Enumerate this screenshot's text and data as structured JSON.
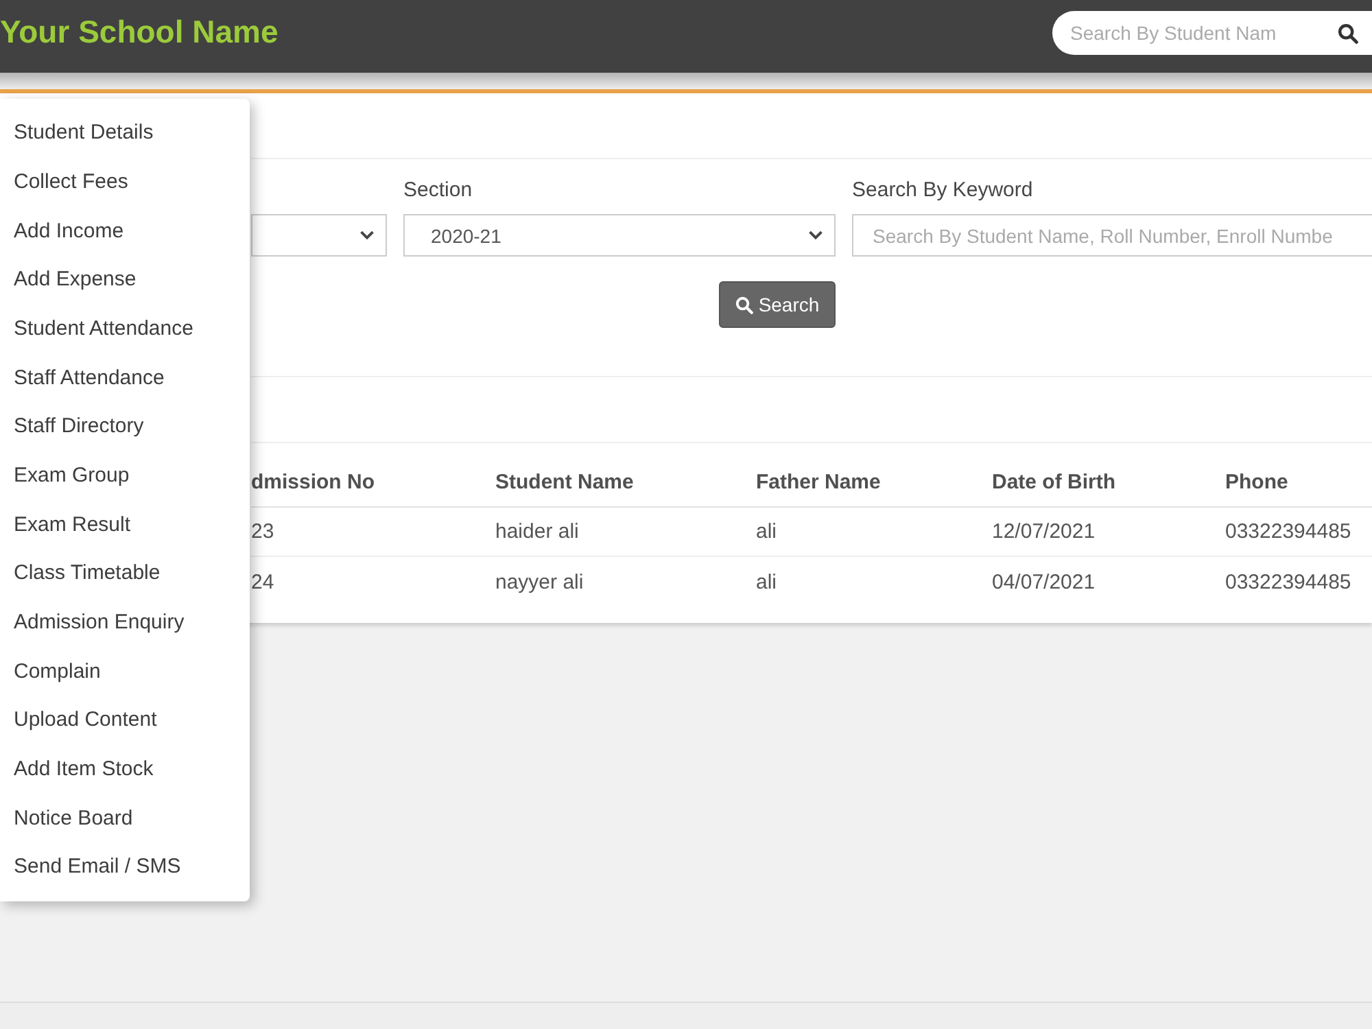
{
  "header": {
    "title": "Your School Name",
    "search": {
      "placeholder": "Search By Student Nam"
    }
  },
  "menu": {
    "items": [
      "Student Details",
      "Collect Fees",
      "Add Income",
      "Add Expense",
      "Student Attendance",
      "Staff Attendance",
      "Staff Directory",
      "Exam Group",
      "Exam Result",
      "Class Timetable",
      "Admission Enquiry",
      "Complain",
      "Upload Content",
      "Add Item Stock",
      "Notice Board",
      "Send Email / SMS"
    ]
  },
  "filters": [
    {
      "kind": "select"
    },
    {
      "kind": "select",
      "label": "Section",
      "value": "2020-21"
    },
    {
      "kind": "input",
      "label": "Search By Keyword",
      "placeholder": "Search By Student Name, Roll Number, Enroll Numbe"
    }
  ],
  "search_button": {
    "label": "Search"
  },
  "table": {
    "columns": [
      "dmission No",
      "Student Name",
      "Father Name",
      "Date of Birth",
      "Phone"
    ],
    "rows": [
      [
        "23",
        "haider ali",
        "ali",
        "12/07/2021",
        "03322394485"
      ],
      [
        "24",
        "nayyer ali",
        "ali",
        "04/07/2021",
        "03322394485"
      ]
    ]
  }
}
